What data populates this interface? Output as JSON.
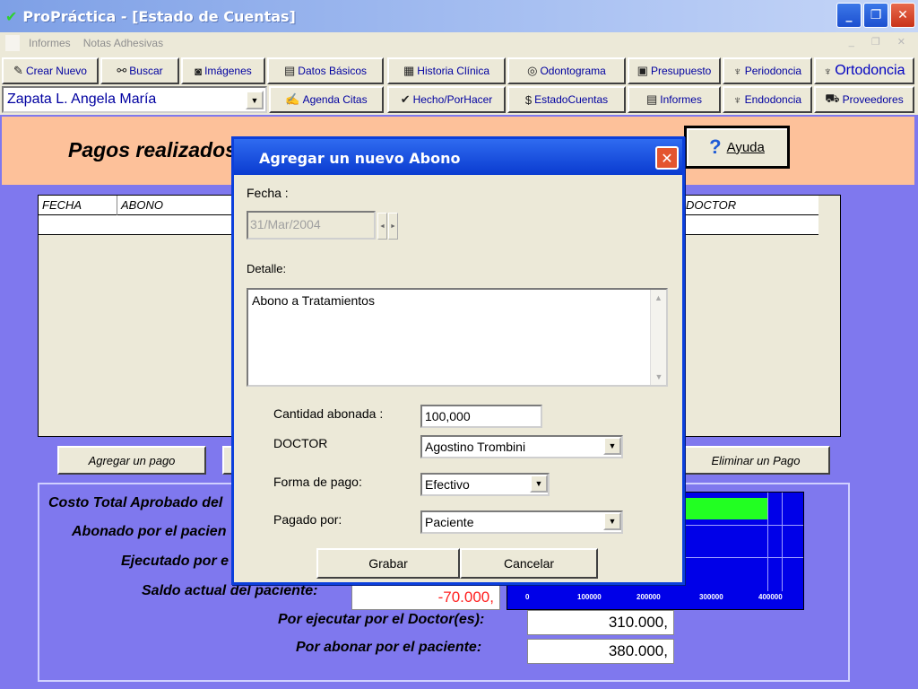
{
  "window": {
    "title": "ProPráctica - [Estado de Cuentas]",
    "app_icon": "checkmark-icon",
    "controls": [
      "minimize-icon",
      "restore-icon",
      "close-icon"
    ]
  },
  "menubar": {
    "items": [
      "Informes",
      "Notas Adhesivas"
    ]
  },
  "toolbar": {
    "row1": [
      {
        "label": "Crear Nuevo",
        "icon": "pointer-icon"
      },
      {
        "label": "Buscar",
        "icon": "binoculars-icon"
      },
      {
        "label": "Imágenes",
        "icon": "camera-icon"
      },
      {
        "label": "Datos Básicos",
        "icon": "card-icon"
      },
      {
        "label": "Historia Clínica",
        "icon": "printer-icon"
      },
      {
        "label": "Odontograma",
        "icon": "odontogram-icon"
      },
      {
        "label": "Presupuesto",
        "icon": "keyboard-icon"
      },
      {
        "label": "Periodoncia",
        "icon": "tooth-icon"
      },
      {
        "label": "Ortodoncia",
        "icon": "braces-icon"
      }
    ],
    "row2": [
      {
        "label": "Agenda Citas",
        "icon": "agenda-icon"
      },
      {
        "label": "Hecho/PorHacer",
        "icon": "check-icon"
      },
      {
        "label": "EstadoCuentas",
        "icon": "money-icon"
      },
      {
        "label": "Informes",
        "icon": "document-icon"
      },
      {
        "label": "Endodoncia",
        "icon": "tooth-icon"
      },
      {
        "label": "Proveedores",
        "icon": "truck-icon"
      }
    ],
    "patient": "Zapata L. Angela María"
  },
  "main": {
    "heading": "Pagos realizados",
    "help_label": "Ayuda",
    "grid_columns": [
      "FECHA",
      "ABONO",
      "DOCTOR"
    ],
    "buttons": {
      "add_payment": "Agregar un pago",
      "delete_payment": "Eliminar un Pago"
    },
    "summary": {
      "approved_label": "Costo Total Aprobado del",
      "paid_label": "Abonado por el pacien",
      "executed_label": "Ejecutado por e",
      "balance_label": "Saldo actual del paciente:",
      "balance_value": "-70.000,",
      "to_execute_label": "Por ejecutar por el Doctor(es):",
      "to_execute_value": "310.000,",
      "to_pay_label": "Por abonar por el paciente:",
      "to_pay_value": "380.000,"
    }
  },
  "chart_data": {
    "type": "bar",
    "orientation": "horizontal",
    "x_ticks": [
      "0",
      "100000",
      "200000",
      "300000",
      "400000"
    ],
    "xlim": [
      0,
      400000
    ],
    "colors": {
      "background": "#0000e8",
      "bar": "#22ff22"
    }
  },
  "dialog": {
    "title": "Agregar un nuevo  Abono",
    "date_label": "Fecha :",
    "date_value": "31/Mar/2004",
    "detail_label": "Detalle:",
    "detail_value": "Abono a Tratamientos",
    "amount_label": "Cantidad abonada :",
    "amount_value": "100,000",
    "doctor_label": "DOCTOR",
    "doctor_value": "Agostino Trombini",
    "payment_method_label": "Forma de pago:",
    "payment_method_value": "Efectivo",
    "paid_by_label": "Pagado por:",
    "paid_by_value": "Paciente",
    "save_label": "Grabar",
    "cancel_label": "Cancelar"
  }
}
